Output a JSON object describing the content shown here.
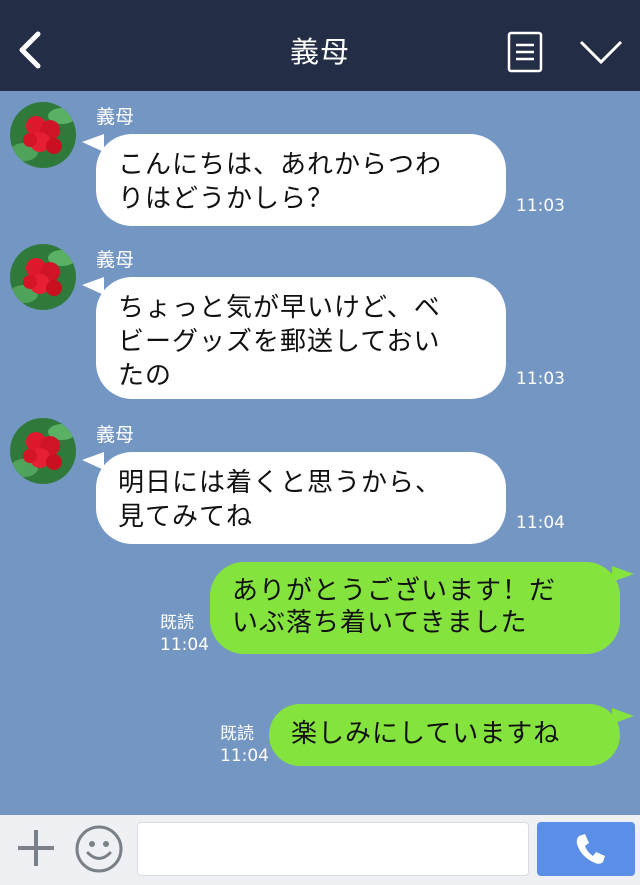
{
  "header": {
    "title": "義母",
    "back_icon": "chevron-left-icon",
    "menu_icon": "document-menu-icon",
    "expand_icon": "chevron-down-icon"
  },
  "messages": [
    {
      "direction": "incoming",
      "sender": "義母",
      "lines": [
        "こんにちは、あれからつわ",
        "りはどうかしら？"
      ],
      "time": "11:03"
    },
    {
      "direction": "incoming",
      "sender": "義母",
      "lines": [
        "ちょっと気が早いけど、ベ",
        "ビーグッズを郵送しておい",
        "たの"
      ],
      "time": "11:03"
    },
    {
      "direction": "incoming",
      "sender": "義母",
      "lines": [
        "明日には着くと思うから、",
        "見てみてね"
      ],
      "time": "11:04"
    },
    {
      "direction": "outgoing",
      "lines": [
        "ありがとうございます！だ",
        "いぶ落ち着いてきました"
      ],
      "read": "既読",
      "time": "11:04"
    },
    {
      "direction": "outgoing",
      "lines": [
        "楽しみにしていますね"
      ],
      "read": "既読",
      "time": "11:04"
    }
  ],
  "footer": {
    "input_value": "",
    "plus_icon": "plus-icon",
    "emoji_icon": "smiley-icon",
    "send_icon": "phone-icon"
  },
  "colors": {
    "header_bg": "#232d45",
    "chat_bg": "#7396c3",
    "incoming_bubble": "#ffffff",
    "outgoing_bubble": "#84e33d",
    "send_button": "#5b8ee6"
  }
}
